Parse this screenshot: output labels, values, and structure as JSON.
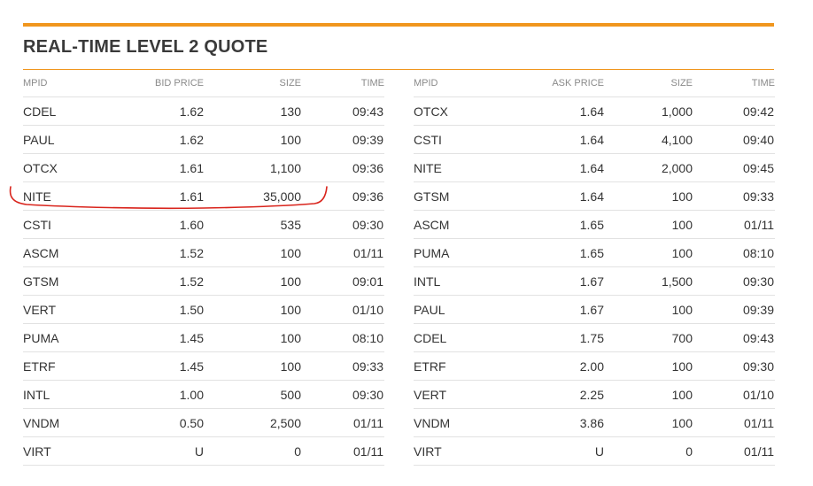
{
  "title": "REAL-TIME LEVEL 2 QUOTE",
  "colors": {
    "accent": "#f0961e",
    "annotation": "#d9241c"
  },
  "bid": {
    "headers": [
      "MPID",
      "BID PRICE",
      "SIZE",
      "TIME"
    ],
    "rows": [
      [
        "CDEL",
        "1.62",
        "130",
        "09:43"
      ],
      [
        "PAUL",
        "1.62",
        "100",
        "09:39"
      ],
      [
        "OTCX",
        "1.61",
        "1,100",
        "09:36"
      ],
      [
        "NITE",
        "1.61",
        "35,000",
        "09:36"
      ],
      [
        "CSTI",
        "1.60",
        "535",
        "09:30"
      ],
      [
        "ASCM",
        "1.52",
        "100",
        "01/11"
      ],
      [
        "GTSM",
        "1.52",
        "100",
        "09:01"
      ],
      [
        "VERT",
        "1.50",
        "100",
        "01/10"
      ],
      [
        "PUMA",
        "1.45",
        "100",
        "08:10"
      ],
      [
        "ETRF",
        "1.45",
        "100",
        "09:33"
      ],
      [
        "INTL",
        "1.00",
        "500",
        "09:30"
      ],
      [
        "VNDM",
        "0.50",
        "2,500",
        "01/11"
      ],
      [
        "VIRT",
        "U",
        "0",
        "01/11"
      ]
    ]
  },
  "ask": {
    "headers": [
      "MPID",
      "ASK PRICE",
      "SIZE",
      "TIME"
    ],
    "rows": [
      [
        "OTCX",
        "1.64",
        "1,000",
        "09:42"
      ],
      [
        "CSTI",
        "1.64",
        "4,100",
        "09:40"
      ],
      [
        "NITE",
        "1.64",
        "2,000",
        "09:45"
      ],
      [
        "GTSM",
        "1.64",
        "100",
        "09:33"
      ],
      [
        "ASCM",
        "1.65",
        "100",
        "01/11"
      ],
      [
        "PUMA",
        "1.65",
        "100",
        "08:10"
      ],
      [
        "INTL",
        "1.67",
        "1,500",
        "09:30"
      ],
      [
        "PAUL",
        "1.67",
        "100",
        "09:39"
      ],
      [
        "CDEL",
        "1.75",
        "700",
        "09:43"
      ],
      [
        "ETRF",
        "2.00",
        "100",
        "09:30"
      ],
      [
        "VERT",
        "2.25",
        "100",
        "01/10"
      ],
      [
        "VNDM",
        "3.86",
        "100",
        "01/11"
      ],
      [
        "VIRT",
        "U",
        "0",
        "01/11"
      ]
    ]
  }
}
